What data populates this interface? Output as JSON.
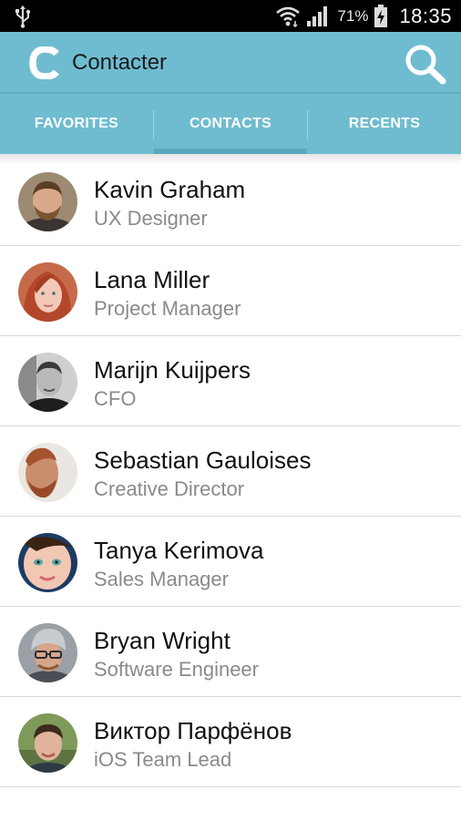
{
  "status_bar": {
    "battery_percent": "71%",
    "time": "18:35",
    "icons": [
      "usb-icon",
      "wifi-icon",
      "signal-icon",
      "battery-charging-icon"
    ]
  },
  "app": {
    "title": "Contacter",
    "logo": "C",
    "accent_color": "#6fbcd0",
    "actions": [
      "search-icon"
    ]
  },
  "tabs": [
    {
      "label": "FAVORITES",
      "selected": false
    },
    {
      "label": "CONTACTS",
      "selected": true
    },
    {
      "label": "RECENTS",
      "selected": false
    }
  ],
  "contacts": [
    {
      "name": "Kavin Graham",
      "role": "UX Designer",
      "avatar": "man-beard-avatar"
    },
    {
      "name": "Lana Miller",
      "role": "Project Manager",
      "avatar": "woman-redhead-avatar"
    },
    {
      "name": "Marijn Kuijpers",
      "role": "CFO",
      "avatar": "man-bw-avatar"
    },
    {
      "name": "Sebastian Gauloises",
      "role": "Creative Director",
      "avatar": "man-bearded-avatar"
    },
    {
      "name": "Tanya Kerimova",
      "role": "Sales Manager",
      "avatar": "woman-blue-eyes-avatar"
    },
    {
      "name": "Bryan Wright",
      "role": "Software Engineer",
      "avatar": "man-glasses-beanie-avatar"
    },
    {
      "name": "Виктор Парфёнов",
      "role": "iOS Team Lead",
      "avatar": "man-smiling-avatar"
    }
  ]
}
